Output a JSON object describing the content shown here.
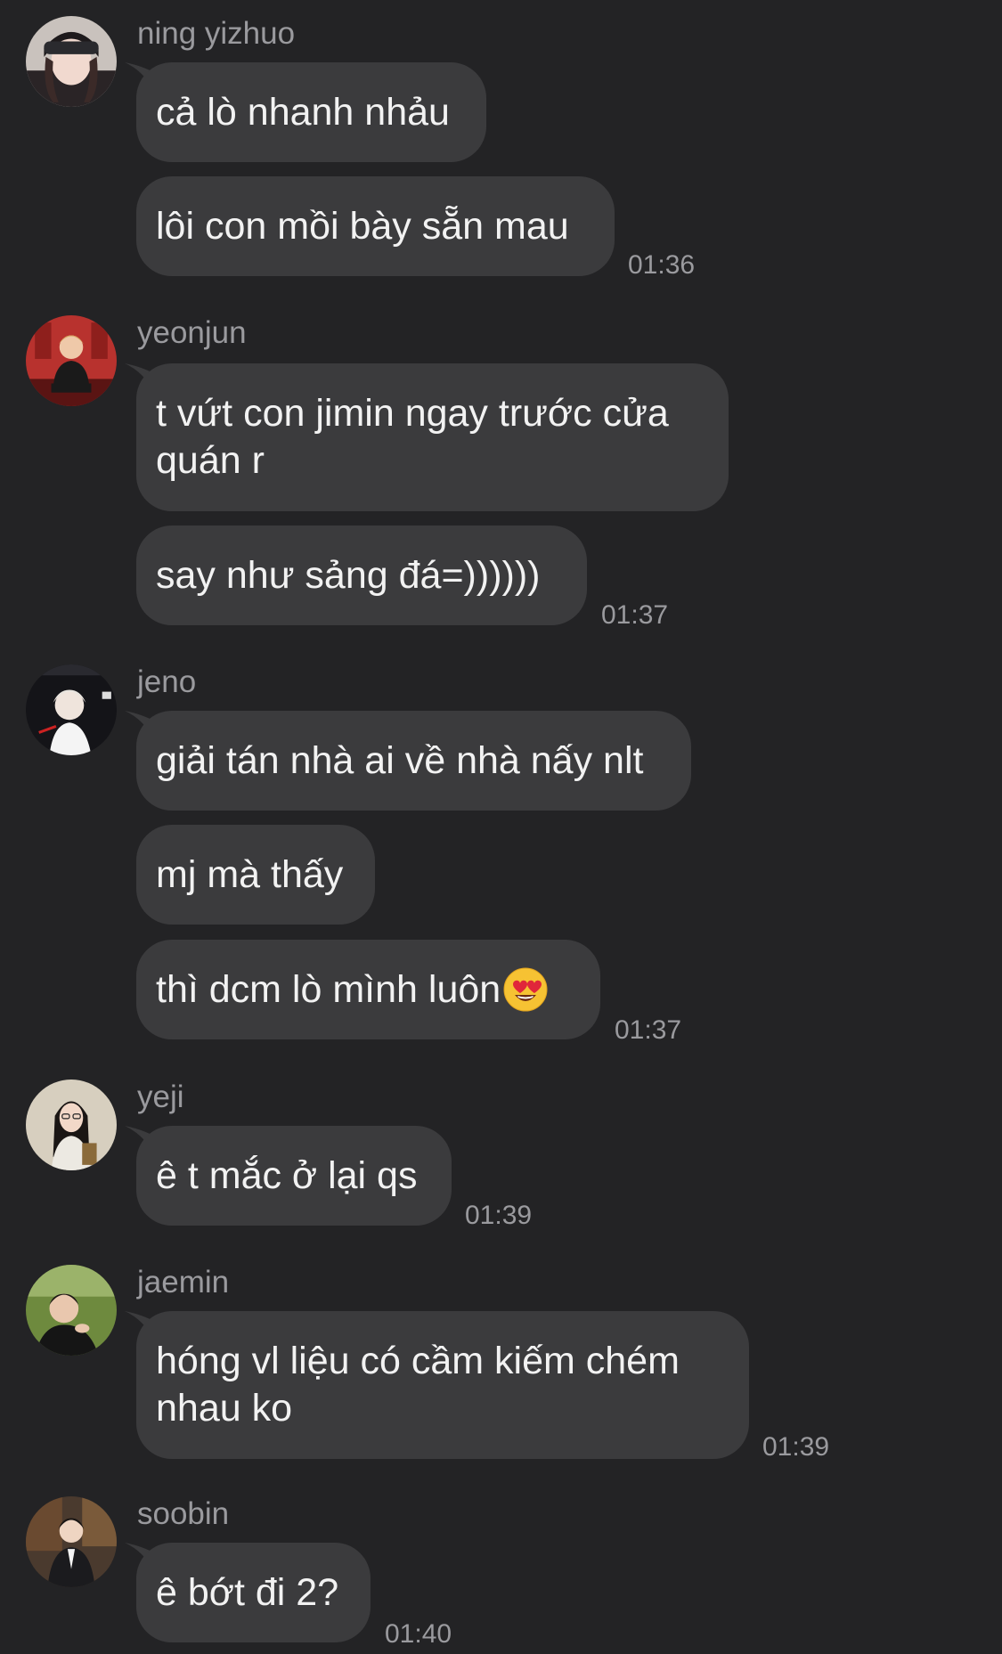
{
  "messages": [
    {
      "sender": "ning yizhuo",
      "avatar_icon": "avatar-ning-yizhuo",
      "bubbles": [
        "cả lò nhanh nhảu",
        "lôi con mồi bày sẵn mau"
      ],
      "time": "01:36"
    },
    {
      "sender": "yeonjun",
      "avatar_icon": "avatar-yeonjun",
      "bubbles": [
        "t vứt con jimin ngay trước cửa\nquán r",
        "say như sảng đá=))))))"
      ],
      "time": "01:37"
    },
    {
      "sender": "jeno",
      "avatar_icon": "avatar-jeno",
      "bubbles": [
        "giải tán nhà ai về nhà nấy nlt",
        "mj mà thấy",
        "thì dcm lò mình luôn"
      ],
      "emoji": "heart-eyes-emoji",
      "time": "01:37"
    },
    {
      "sender": "yeji",
      "avatar_icon": "avatar-yeji",
      "bubbles": [
        "ê t mắc ở lại qs"
      ],
      "time": "01:39"
    },
    {
      "sender": "jaemin",
      "avatar_icon": "avatar-jaemin",
      "bubbles": [
        "hóng vl liệu có cầm kiếm chém\nnhau ko"
      ],
      "time": "01:39"
    },
    {
      "sender": "soobin",
      "avatar_icon": "avatar-soobin",
      "bubbles": [
        "ê bớt đi 2?"
      ],
      "time": "01:40"
    }
  ],
  "colors": {
    "background": "#232325",
    "bubble": "#3b3b3d",
    "text": "#f2f2f2",
    "meta": "#9a9a9e"
  }
}
